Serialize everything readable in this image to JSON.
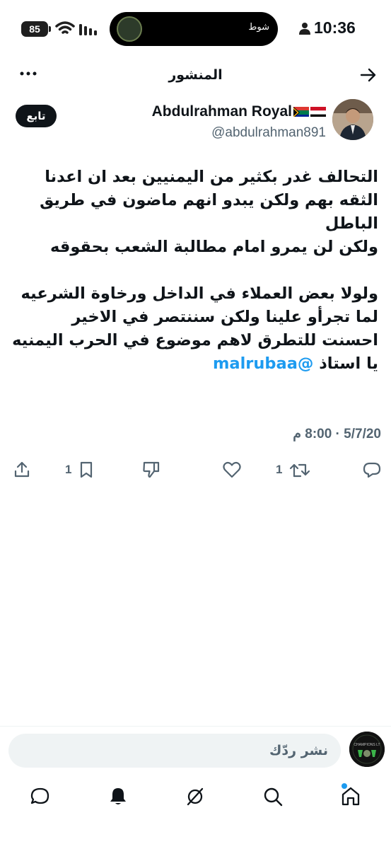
{
  "status_bar": {
    "time": "10:36",
    "battery": "85",
    "island_text": "شوط"
  },
  "header": {
    "title": "المنشور"
  },
  "author": {
    "name": "Abdulrahman Royal",
    "handle": "@abdulrahman891",
    "follow_label": "تابع"
  },
  "tweet": {
    "text": "التحالف غدر بكثير من اليمنيين بعد ان اعدنا الثقه بهم ولكن يبدو انهم ماضون في طريق الباطل\nولكن لن يمرو امام مطالبة الشعب بحقوقه\n\nولولا بعض العملاء في الداخل ورخاوة الشرعيه لما تجرأو علينا ولكن سننتصر في الاخير احسنت للتطرق لاهم موضوع في الحرب اليمنيه يا استاذ ",
    "mention": "@malrubaa",
    "timestamp": "5/7/20 · 8:00 م"
  },
  "actions": {
    "reply_count": "",
    "retweet_count": "1",
    "bookmark_count": "1"
  },
  "reply_bar": {
    "placeholder": "نشر ردّك"
  },
  "colors": {
    "accent": "#1d9bf0",
    "text": "#0f1419",
    "muted": "#536471"
  }
}
